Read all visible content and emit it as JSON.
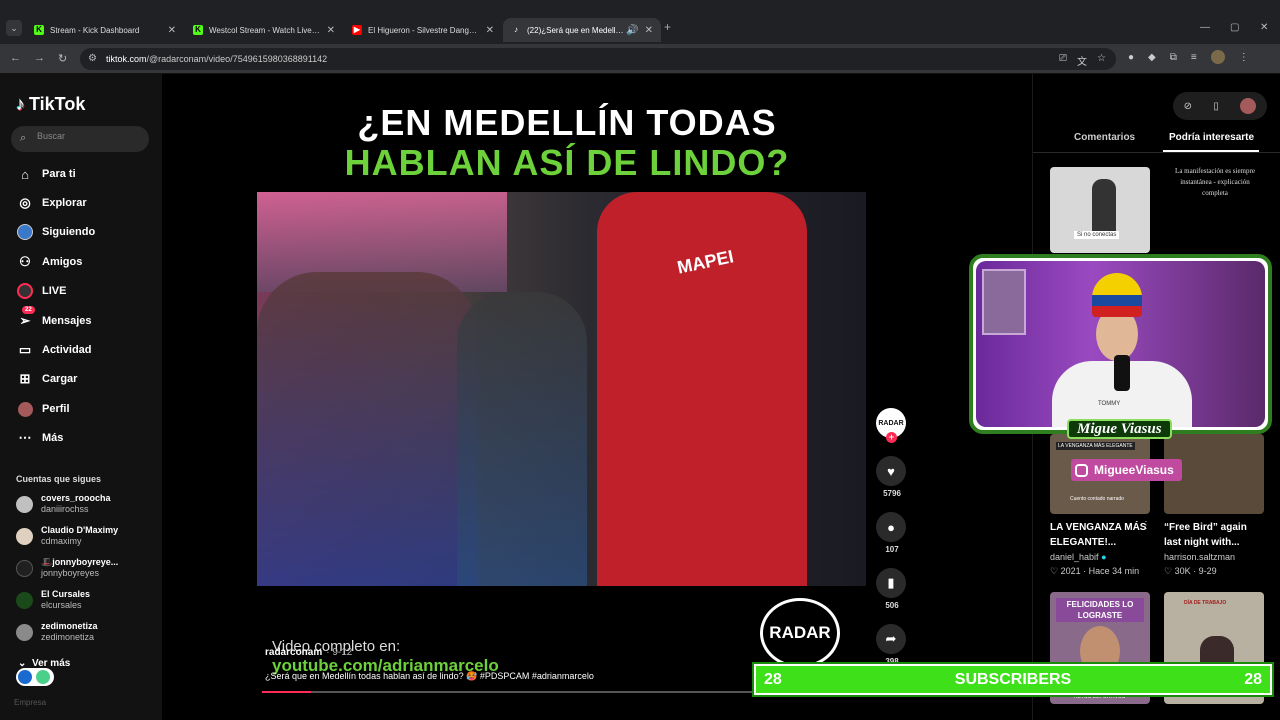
{
  "browser": {
    "tabs": [
      {
        "title": "Stream - Kick Dashboard",
        "icon": "kick-icon",
        "color": "#53fc18"
      },
      {
        "title": "Westcol Stream - Watch Live on Kick",
        "icon": "kick-icon",
        "color": "#53fc18"
      },
      {
        "title": "El Higueron - Silvestre Dangond",
        "icon": "youtube-icon",
        "color": "#ff0000"
      },
      {
        "title": "(22)¿Será que en Medellín todas",
        "icon": "tiktok-icon",
        "color": "#ffffff"
      }
    ],
    "url_host": "tiktok.com",
    "url_path": "/@radarconam/video/7549615980368891142"
  },
  "sidebar": {
    "logo": "TikTok",
    "search_placeholder": "Buscar",
    "nav": [
      {
        "label": "Para ti",
        "icon": "home-icon"
      },
      {
        "label": "Explorar",
        "icon": "compass-icon"
      },
      {
        "label": "Siguiendo",
        "icon": "following-avatar-icon"
      },
      {
        "label": "Amigos",
        "icon": "friends-icon"
      },
      {
        "label": "LIVE",
        "icon": "live-icon"
      },
      {
        "label": "Mensajes",
        "icon": "messages-icon",
        "badge": "22"
      },
      {
        "label": "Actividad",
        "icon": "activity-icon"
      },
      {
        "label": "Cargar",
        "icon": "upload-icon"
      },
      {
        "label": "Perfil",
        "icon": "profile-icon"
      },
      {
        "label": "Más",
        "icon": "more-icon"
      }
    ],
    "following_title": "Cuentas que sigues",
    "following": [
      {
        "name": "covers_rooocha",
        "handle": "daniiirochss",
        "color": "#c0c0c0"
      },
      {
        "name": "Claudio D'Maximy",
        "handle": "cdmaximy",
        "color": "#e0d0c0"
      },
      {
        "name": "🎩jonnyboyreye...",
        "handle": "jonnyboyreyes",
        "color": "#202020"
      },
      {
        "name": "El Cursales",
        "handle": "elcursales",
        "color": "#1a4a1a"
      },
      {
        "name": "zedimonetiza",
        "handle": "zedimonetiza",
        "color": "#8a8a8a"
      }
    ],
    "more_label": "Ver más",
    "footer_text": "Empresa"
  },
  "video": {
    "headline_line1": "¿EN MEDELLÍN TODAS",
    "headline_line2": "HABLAN ASÍ DE LINDO?",
    "jersey_text": "MAPEI",
    "overlay_line1": "Video completo en:",
    "overlay_line2": "youtube.com/adrianmarcelo",
    "watermark": "RADAR",
    "author": "radarconam",
    "date": "· 9-12",
    "caption": "¿Será que en Medellín todas hablan así de lindo? 🥵 #PDSPCAM #adrianmarcelo",
    "progress": 0.08,
    "creator_avatar_text": "RADAR",
    "likes": "5796",
    "comments": "107",
    "saves": "506",
    "shares": "398"
  },
  "right_panel": {
    "tab_comments": "Comentarios",
    "tab_related": "Podría interesarte",
    "related": [
      {
        "thumb_label": "Si no conectas",
        "caption": "La manifestación es siempre instantánea - explicación completa"
      },
      {
        "thumb_label": "LA VENGANZA MÁS ELEGANTE",
        "thumb_sub": "Cuento contado narrado",
        "title": "LA VENGANZA MÁS ELEGANTE!...",
        "user": "daniel_habif",
        "likes": "♡ 2021",
        "time": "· Hace 34 min"
      },
      {
        "title": "“Free Bird” again last night with...",
        "user": "harrison.saltzman",
        "likes": "♡ 30K",
        "time": "· 9-29"
      },
      {
        "thumb_label": "FELICIDADES LO LOGRASTE",
        "thumb_sub": "RETOS DEPORTIVOS"
      },
      {
        "thumb_label": "DÍA DE TRABAJO"
      }
    ]
  },
  "stream_overlay": {
    "streamer_name": "Migue Viasus",
    "cam_shirt": "TOMMY",
    "instagram": "MigueeViasus",
    "subscribers_left": "28",
    "subscribers_label": "SUBSCRIBERS",
    "subscribers_right": "28"
  }
}
